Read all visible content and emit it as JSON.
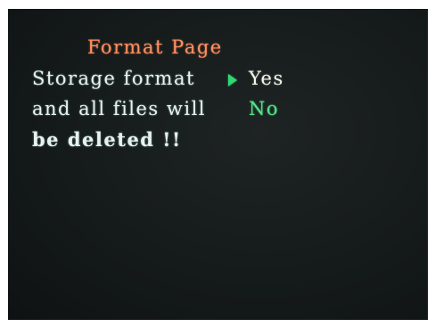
{
  "title": "Format Page",
  "message": {
    "line1": "Storage format",
    "line2": "and all files will",
    "line3": "be deleted !!"
  },
  "options": {
    "yes": "Yes",
    "no": "No",
    "selected": "yes"
  },
  "colors": {
    "title": "#ff9060",
    "message": "#e6f2f0",
    "selection_cursor": "#2fd873",
    "unselected_option": "#58e38a",
    "screen_background": "#151a1a"
  },
  "icons": {
    "cursor": "triangle-right-icon"
  }
}
